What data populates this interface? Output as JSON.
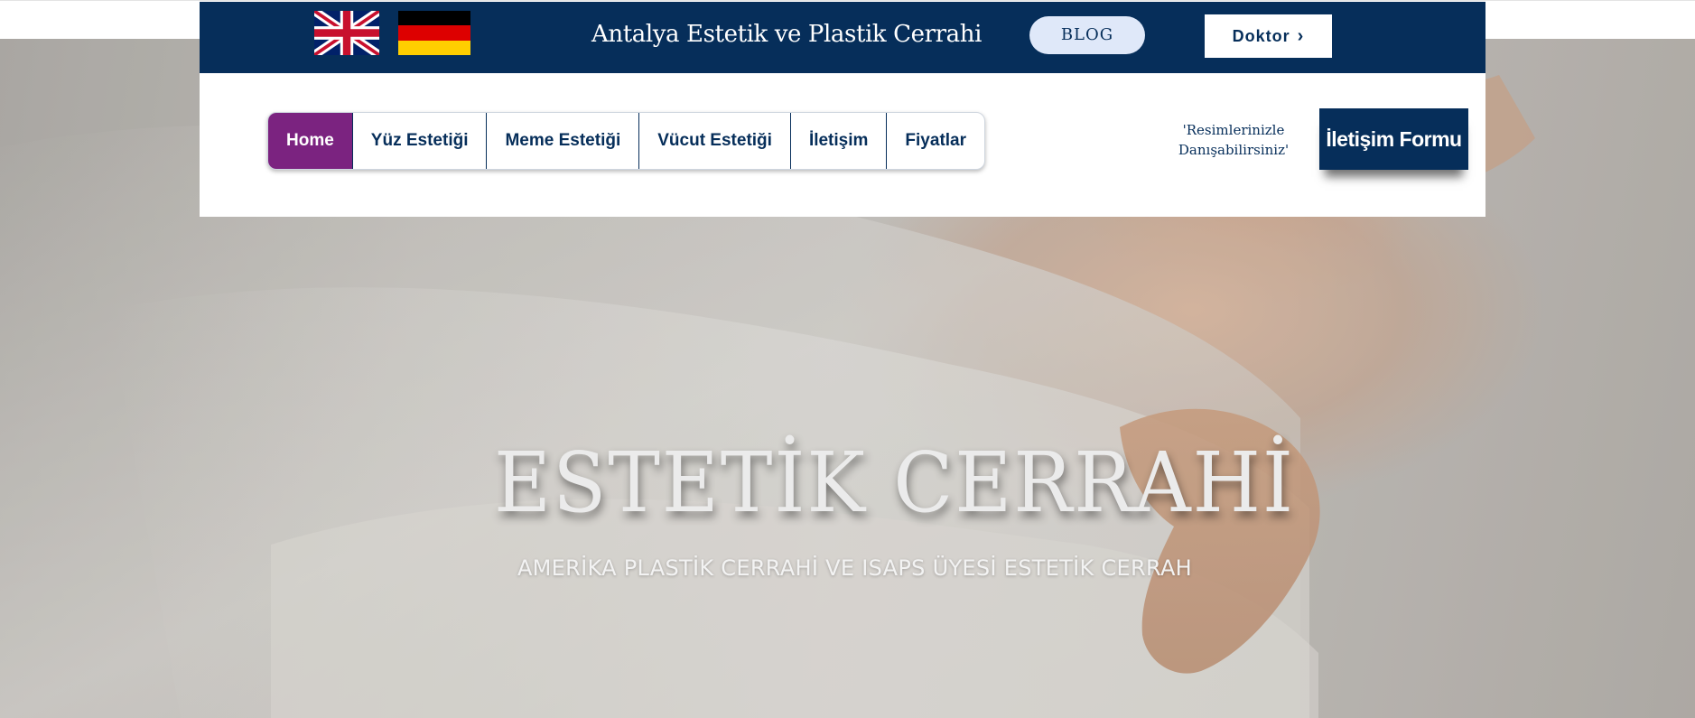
{
  "header": {
    "languages": [
      {
        "name": "english-flag-icon"
      },
      {
        "name": "german-flag-icon"
      }
    ],
    "site_title": "Antalya Estetik ve Plastik Cerrahi",
    "blog_label": "BLOG",
    "doktor_label": "Doktor",
    "colors": {
      "bar": "#062e5a",
      "blog_bg": "#dfe8f9",
      "active_nav": "#7b2380"
    }
  },
  "nav": {
    "items": [
      {
        "label": "Home",
        "active": true
      },
      {
        "label": "Yüz Estetiği"
      },
      {
        "label": "Meme Estetiği"
      },
      {
        "label": "Vücut Estetiği"
      },
      {
        "label": "İletişim"
      },
      {
        "label": "Fiyatlar"
      }
    ]
  },
  "contact": {
    "note_line1": "'Resimlerinizle",
    "note_line2": "Danışabilirsiniz'",
    "form_button": "İletişim Formu"
  },
  "hero": {
    "title": "ESTETİK CERRAHİ",
    "subtitle": "AMERİKA PLASTİK CERRAHİ VE ISAPS ÜYESİ ESTETİK CERRAH"
  }
}
